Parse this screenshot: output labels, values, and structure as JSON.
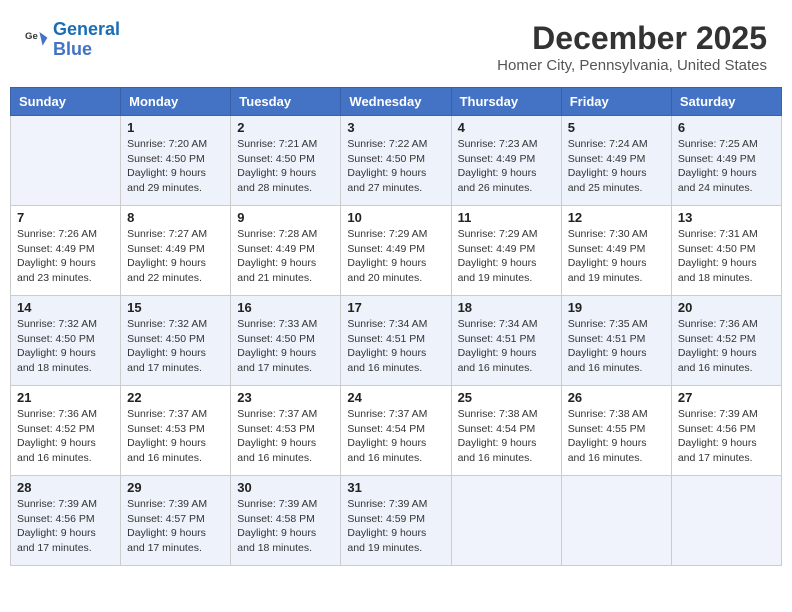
{
  "logo": {
    "line1": "General",
    "line2": "Blue"
  },
  "title": "December 2025",
  "subtitle": "Homer City, Pennsylvania, United States",
  "days_of_week": [
    "Sunday",
    "Monday",
    "Tuesday",
    "Wednesday",
    "Thursday",
    "Friday",
    "Saturday"
  ],
  "weeks": [
    [
      {
        "day": "",
        "sunrise": "",
        "sunset": "",
        "daylight": ""
      },
      {
        "day": "1",
        "sunrise": "7:20 AM",
        "sunset": "4:50 PM",
        "daylight": "9 hours and 29 minutes."
      },
      {
        "day": "2",
        "sunrise": "7:21 AM",
        "sunset": "4:50 PM",
        "daylight": "9 hours and 28 minutes."
      },
      {
        "day": "3",
        "sunrise": "7:22 AM",
        "sunset": "4:50 PM",
        "daylight": "9 hours and 27 minutes."
      },
      {
        "day": "4",
        "sunrise": "7:23 AM",
        "sunset": "4:49 PM",
        "daylight": "9 hours and 26 minutes."
      },
      {
        "day": "5",
        "sunrise": "7:24 AM",
        "sunset": "4:49 PM",
        "daylight": "9 hours and 25 minutes."
      },
      {
        "day": "6",
        "sunrise": "7:25 AM",
        "sunset": "4:49 PM",
        "daylight": "9 hours and 24 minutes."
      }
    ],
    [
      {
        "day": "7",
        "sunrise": "7:26 AM",
        "sunset": "4:49 PM",
        "daylight": "9 hours and 23 minutes."
      },
      {
        "day": "8",
        "sunrise": "7:27 AM",
        "sunset": "4:49 PM",
        "daylight": "9 hours and 22 minutes."
      },
      {
        "day": "9",
        "sunrise": "7:28 AM",
        "sunset": "4:49 PM",
        "daylight": "9 hours and 21 minutes."
      },
      {
        "day": "10",
        "sunrise": "7:29 AM",
        "sunset": "4:49 PM",
        "daylight": "9 hours and 20 minutes."
      },
      {
        "day": "11",
        "sunrise": "7:29 AM",
        "sunset": "4:49 PM",
        "daylight": "9 hours and 19 minutes."
      },
      {
        "day": "12",
        "sunrise": "7:30 AM",
        "sunset": "4:49 PM",
        "daylight": "9 hours and 19 minutes."
      },
      {
        "day": "13",
        "sunrise": "7:31 AM",
        "sunset": "4:50 PM",
        "daylight": "9 hours and 18 minutes."
      }
    ],
    [
      {
        "day": "14",
        "sunrise": "7:32 AM",
        "sunset": "4:50 PM",
        "daylight": "9 hours and 18 minutes."
      },
      {
        "day": "15",
        "sunrise": "7:32 AM",
        "sunset": "4:50 PM",
        "daylight": "9 hours and 17 minutes."
      },
      {
        "day": "16",
        "sunrise": "7:33 AM",
        "sunset": "4:50 PM",
        "daylight": "9 hours and 17 minutes."
      },
      {
        "day": "17",
        "sunrise": "7:34 AM",
        "sunset": "4:51 PM",
        "daylight": "9 hours and 16 minutes."
      },
      {
        "day": "18",
        "sunrise": "7:34 AM",
        "sunset": "4:51 PM",
        "daylight": "9 hours and 16 minutes."
      },
      {
        "day": "19",
        "sunrise": "7:35 AM",
        "sunset": "4:51 PM",
        "daylight": "9 hours and 16 minutes."
      },
      {
        "day": "20",
        "sunrise": "7:36 AM",
        "sunset": "4:52 PM",
        "daylight": "9 hours and 16 minutes."
      }
    ],
    [
      {
        "day": "21",
        "sunrise": "7:36 AM",
        "sunset": "4:52 PM",
        "daylight": "9 hours and 16 minutes."
      },
      {
        "day": "22",
        "sunrise": "7:37 AM",
        "sunset": "4:53 PM",
        "daylight": "9 hours and 16 minutes."
      },
      {
        "day": "23",
        "sunrise": "7:37 AM",
        "sunset": "4:53 PM",
        "daylight": "9 hours and 16 minutes."
      },
      {
        "day": "24",
        "sunrise": "7:37 AM",
        "sunset": "4:54 PM",
        "daylight": "9 hours and 16 minutes."
      },
      {
        "day": "25",
        "sunrise": "7:38 AM",
        "sunset": "4:54 PM",
        "daylight": "9 hours and 16 minutes."
      },
      {
        "day": "26",
        "sunrise": "7:38 AM",
        "sunset": "4:55 PM",
        "daylight": "9 hours and 16 minutes."
      },
      {
        "day": "27",
        "sunrise": "7:39 AM",
        "sunset": "4:56 PM",
        "daylight": "9 hours and 17 minutes."
      }
    ],
    [
      {
        "day": "28",
        "sunrise": "7:39 AM",
        "sunset": "4:56 PM",
        "daylight": "9 hours and 17 minutes."
      },
      {
        "day": "29",
        "sunrise": "7:39 AM",
        "sunset": "4:57 PM",
        "daylight": "9 hours and 17 minutes."
      },
      {
        "day": "30",
        "sunrise": "7:39 AM",
        "sunset": "4:58 PM",
        "daylight": "9 hours and 18 minutes."
      },
      {
        "day": "31",
        "sunrise": "7:39 AM",
        "sunset": "4:59 PM",
        "daylight": "9 hours and 19 minutes."
      },
      {
        "day": "",
        "sunrise": "",
        "sunset": "",
        "daylight": ""
      },
      {
        "day": "",
        "sunrise": "",
        "sunset": "",
        "daylight": ""
      },
      {
        "day": "",
        "sunrise": "",
        "sunset": "",
        "daylight": ""
      }
    ]
  ],
  "labels": {
    "sunrise_prefix": "Sunrise: ",
    "sunset_prefix": "Sunset: ",
    "daylight_prefix": "Daylight: "
  }
}
